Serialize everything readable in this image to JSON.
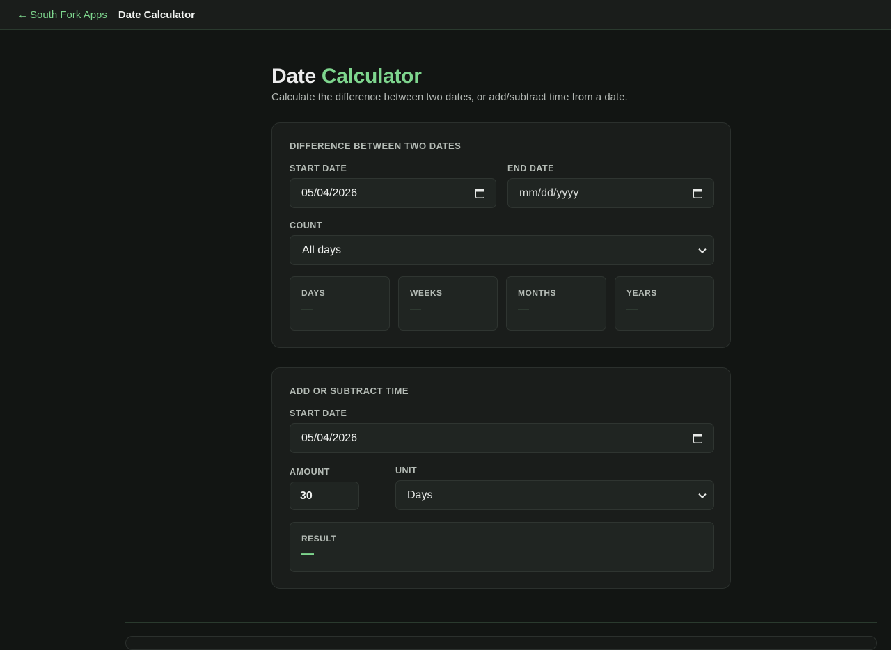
{
  "nav": {
    "back_arrow": "←",
    "back_label": "South Fork Apps",
    "current": "Date Calculator"
  },
  "header": {
    "title_main": "Date",
    "title_accent": "Calculator",
    "subtitle": "Calculate the difference between two dates, or add/subtract time from a date."
  },
  "difference": {
    "section_title": "DIFFERENCE BETWEEN TWO DATES",
    "start_label": "START DATE",
    "start_value": "05/04/2026",
    "end_label": "END DATE",
    "end_placeholder": "mm/dd/yyyy",
    "count_label": "COUNT",
    "count_value": "All days",
    "stats": [
      {
        "label": "DAYS",
        "value": "—"
      },
      {
        "label": "WEEKS",
        "value": "—"
      },
      {
        "label": "MONTHS",
        "value": "—"
      },
      {
        "label": "YEARS",
        "value": "—"
      }
    ]
  },
  "add": {
    "section_title": "ADD OR SUBTRACT TIME",
    "start_label": "START DATE",
    "start_value": "05/04/2026",
    "amount_label": "AMOUNT",
    "amount_value": "30",
    "unit_label": "UNIT",
    "unit_value": "Days",
    "result_label": "RESULT",
    "result_value": "—"
  },
  "colors": {
    "accent": "#7ed68e",
    "background": "#121513",
    "card": "#1a1d1b"
  },
  "icons": [
    "calendar-icon",
    "chevron-down-icon",
    "arrow-left-icon"
  ]
}
